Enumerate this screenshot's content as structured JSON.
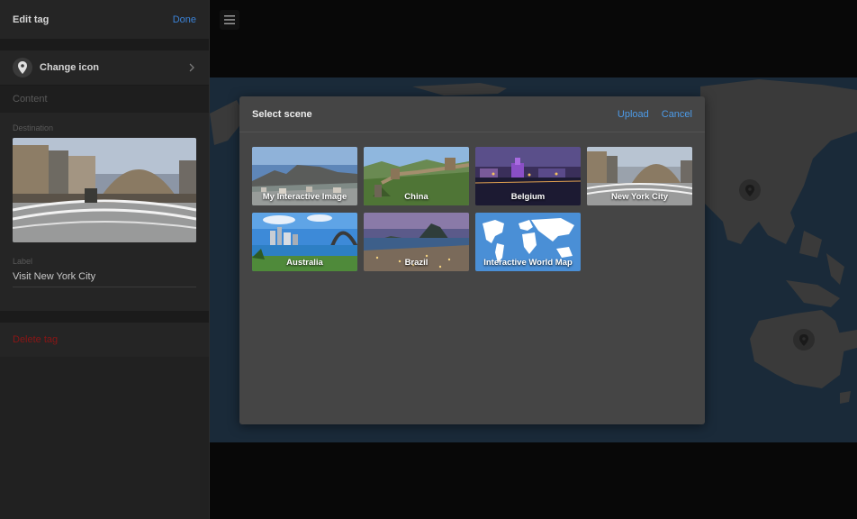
{
  "panel": {
    "title": "Edit tag",
    "done": "Done",
    "change_icon": "Change icon",
    "content": "Content",
    "destination_label": "Destination",
    "label_label": "Label",
    "label_value": "Visit New York City",
    "delete": "Delete tag"
  },
  "modal": {
    "title": "Select scene",
    "upload": "Upload",
    "cancel": "Cancel",
    "scenes": [
      {
        "label": "My Interactive Image"
      },
      {
        "label": "China"
      },
      {
        "label": "Belgium"
      },
      {
        "label": "New York City"
      },
      {
        "label": "Australia"
      },
      {
        "label": "Brazil"
      },
      {
        "label": "Interactive World Map"
      }
    ]
  },
  "colors": {
    "accent": "#3b82d6",
    "danger": "#8a1616",
    "map_water": "#1a2a39",
    "map_land": "#3a3a3a"
  },
  "icons": [
    "map-pin-icon",
    "chevron-right-icon",
    "hamburger-menu-icon"
  ]
}
